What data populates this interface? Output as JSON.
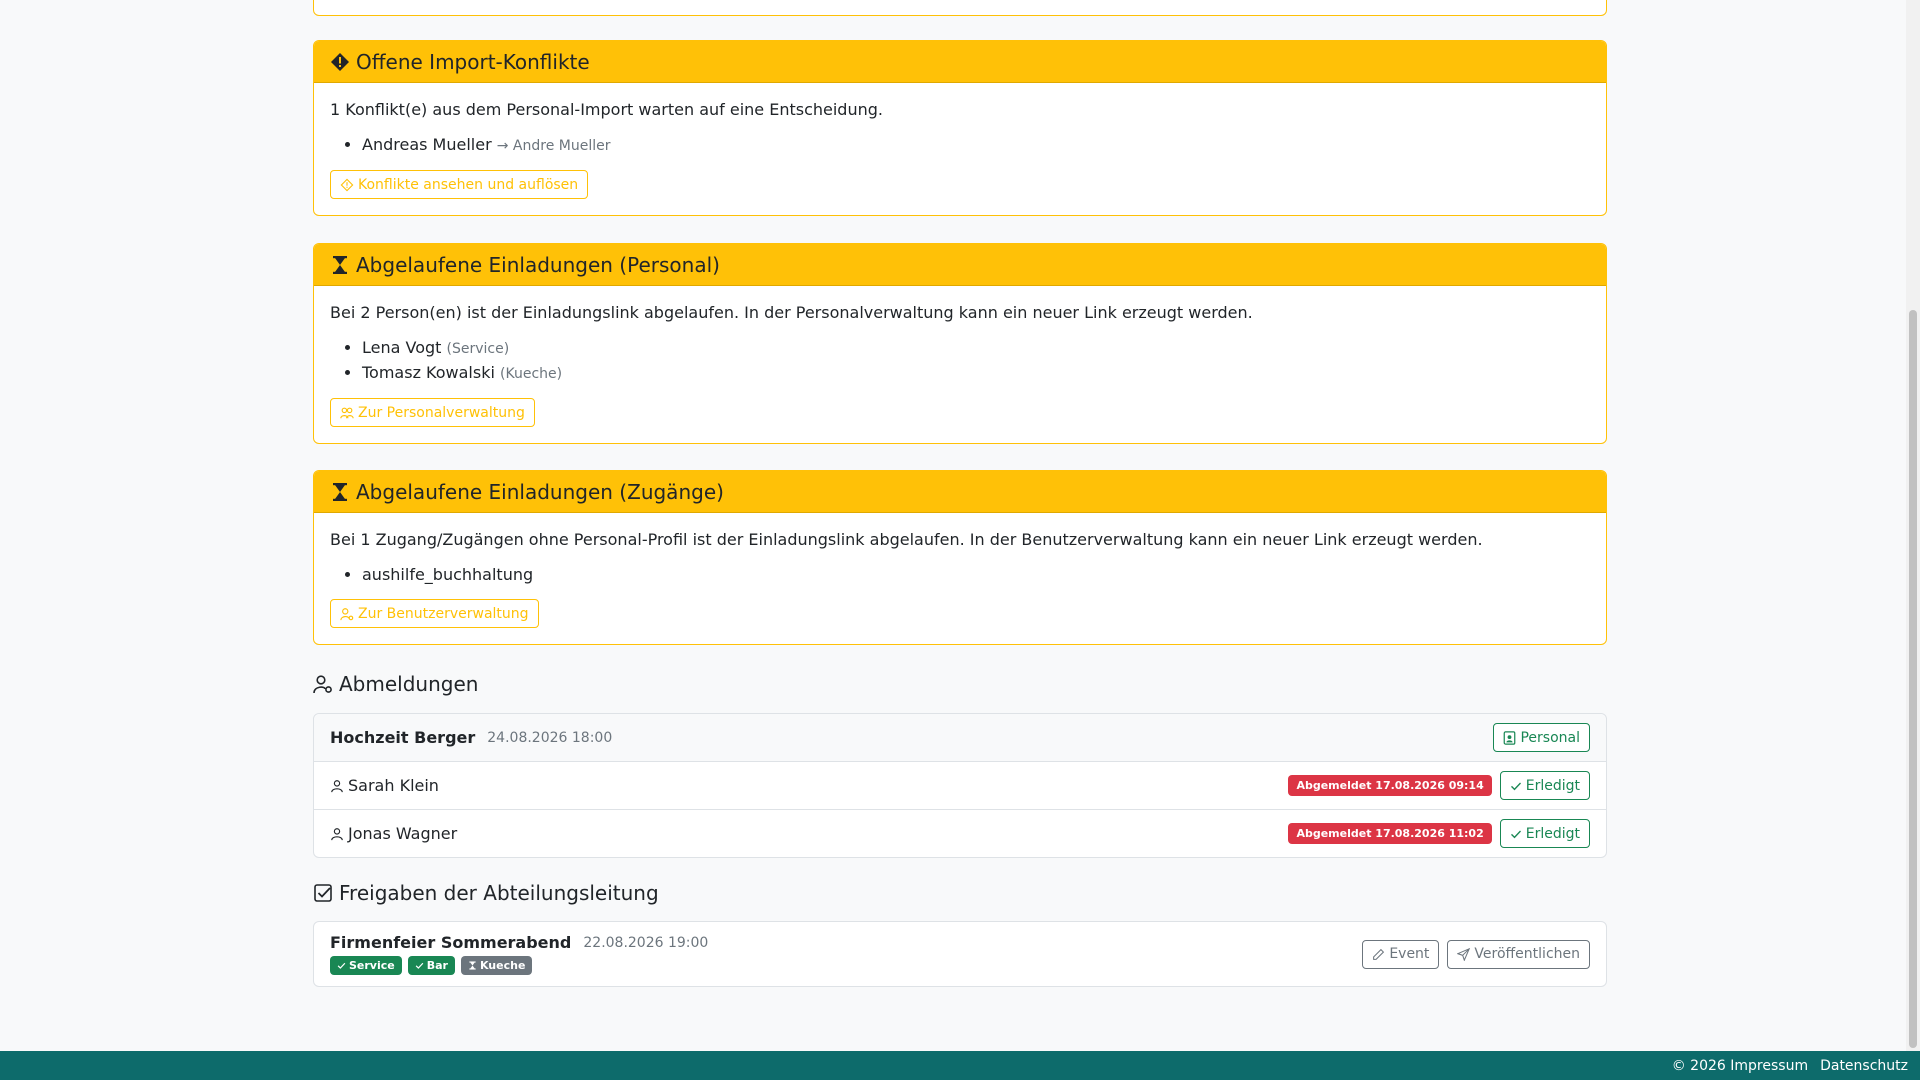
{
  "conflicts": {
    "title": "Offene Import-Konflikte",
    "text": "1 Konflikt(e) aus dem Personal-Import warten auf eine Entscheidung.",
    "items": [
      {
        "name": "Andreas Mueller",
        "target": "→ Andre Mueller"
      }
    ],
    "button": "Konflikte ansehen und auflösen"
  },
  "expired_staff": {
    "title": "Abgelaufene Einladungen (Personal)",
    "text": "Bei 2 Person(en) ist der Einladungslink abgelaufen. In der Personalverwaltung kann ein neuer Link erzeugt werden.",
    "items": [
      {
        "name": "Lena Vogt",
        "dept": "(Service)"
      },
      {
        "name": "Tomasz Kowalski",
        "dept": "(Kueche)"
      }
    ],
    "button": "Zur Personalverwaltung"
  },
  "expired_access": {
    "title": "Abgelaufene Einladungen (Zugänge)",
    "text": "Bei 1 Zugang/Zugängen ohne Personal-Profil ist der Einladungslink abgelaufen. In der Benutzerverwaltung kann ein neuer Link erzeugt werden.",
    "items": [
      {
        "name": "aushilfe_buchhaltung"
      }
    ],
    "button": "Zur Benutzerverwaltung"
  },
  "cancellations": {
    "title": "Abmeldungen",
    "event": {
      "title": "Hochzeit Berger",
      "date": "24.08.2026 18:00",
      "button": "Personal"
    },
    "rows": [
      {
        "name": "Sarah Klein",
        "badge": "Abgemeldet 17.08.2026 09:14",
        "button": "Erledigt"
      },
      {
        "name": "Jonas Wagner",
        "badge": "Abgemeldet 17.08.2026 11:02",
        "button": "Erledigt"
      }
    ]
  },
  "approvals": {
    "title": "Freigaben der Abteilungsleitung",
    "event": {
      "title": "Firmenfeier Sommerabend",
      "date": "22.08.2026 19:00",
      "badges": [
        {
          "label": "Service",
          "status": "approved"
        },
        {
          "label": "Bar",
          "status": "approved"
        },
        {
          "label": "Kueche",
          "status": "pending"
        }
      ],
      "button_event": "Event",
      "button_publish": "Veröffentlichen"
    }
  },
  "footer": {
    "copyright": "© 2026 Impressum",
    "privacy": "Datenschutz"
  },
  "colors": {
    "warning": "#ffc107",
    "success": "#198754",
    "danger": "#dc3545",
    "footer": "#0d6b6b"
  }
}
